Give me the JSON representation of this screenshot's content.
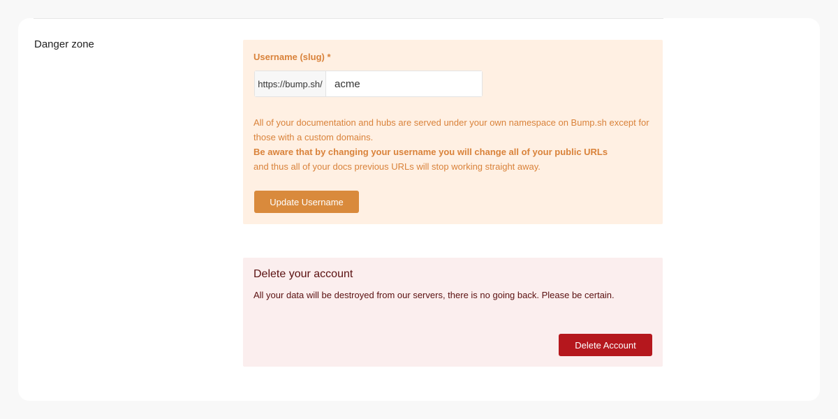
{
  "section": {
    "title": "Danger zone"
  },
  "username": {
    "label": "Username (slug) *",
    "prefix": "https://bump.sh/",
    "value": "acme",
    "help_line1": "All of your documentation and hubs are served under your own namespace on Bump.sh except for those with a custom domains.",
    "help_bold": "Be aware that by changing your username you will change all of your public URLs",
    "help_line2": "and thus all of your docs previous URLs will stop working straight away.",
    "button_label": "Update Username"
  },
  "delete": {
    "title": "Delete your account",
    "description": "All your data will be destroyed from our servers, there is no going back. Please be certain.",
    "button_label": "Delete Account"
  },
  "colors": {
    "warning_bg": "#fff0e3",
    "warning_text": "#d9823a",
    "warning_button": "#d98a3c",
    "danger_bg": "#fbeeee",
    "danger_text": "#5a1010",
    "danger_button": "#b5171d"
  }
}
